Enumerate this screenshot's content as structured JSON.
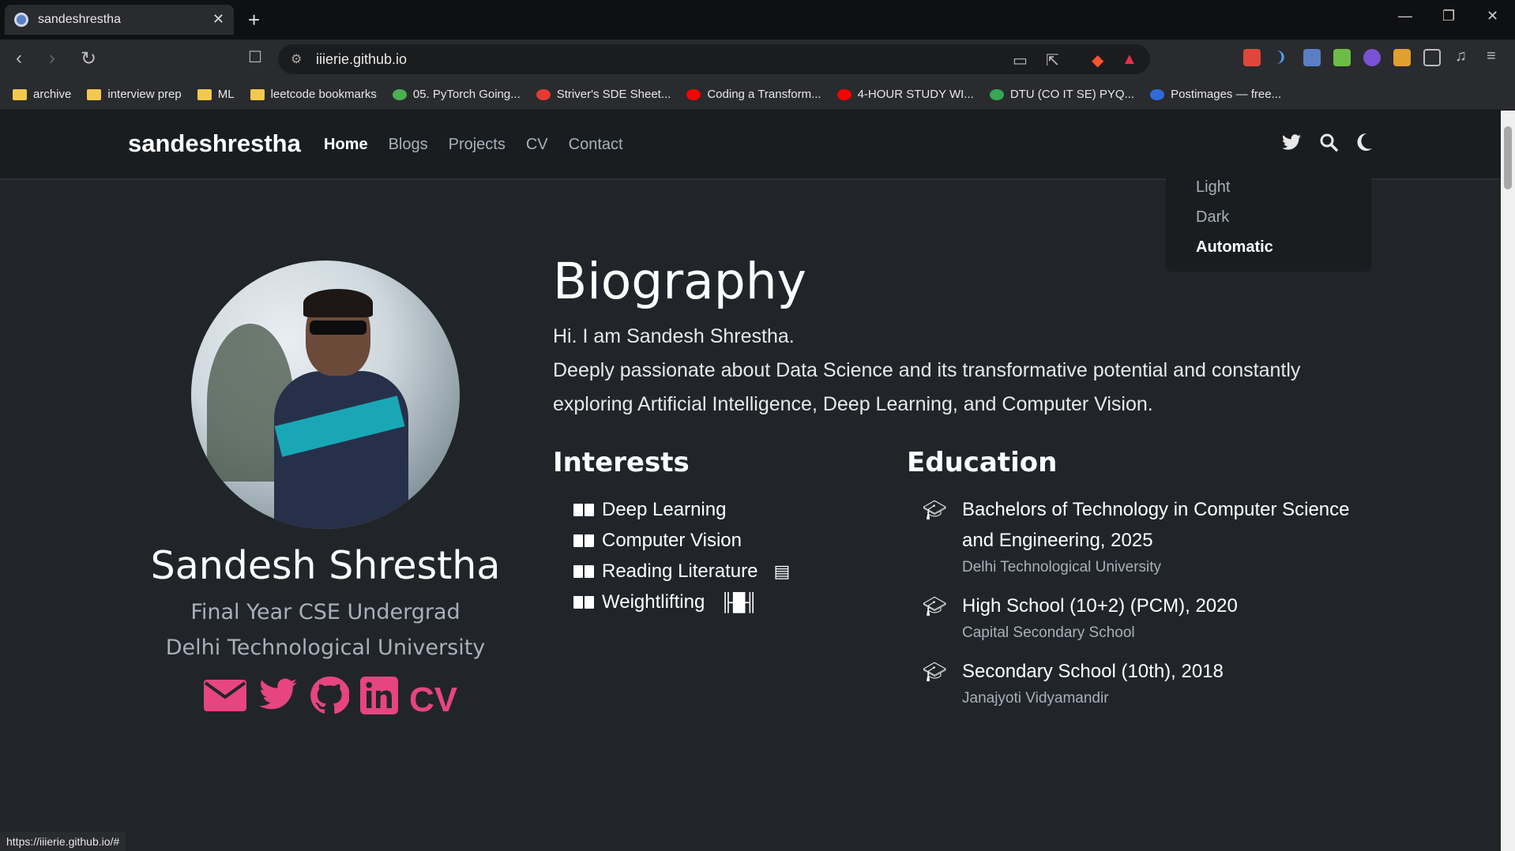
{
  "browser": {
    "tab_title": "sandeshrestha",
    "url": "iiierie.github.io",
    "status_url": "https://iiierie.github.io/#",
    "bookmarks": [
      {
        "label": "archive",
        "icon": "folder-icon"
      },
      {
        "label": "interview prep",
        "icon": "folder-icon"
      },
      {
        "label": "ML",
        "icon": "folder-icon"
      },
      {
        "label": "leetcode bookmarks",
        "icon": "folder-icon"
      },
      {
        "label": "05. PyTorch Going...",
        "icon": "pytorch-icon"
      },
      {
        "label": "Striver's SDE Sheet...",
        "icon": "tuf-icon"
      },
      {
        "label": "Coding a Transform...",
        "icon": "youtube-icon"
      },
      {
        "label": "4-HOUR STUDY WI...",
        "icon": "youtube-icon"
      },
      {
        "label": "DTU (CO IT SE) PYQ...",
        "icon": "drive-icon"
      },
      {
        "label": "Postimages — free...",
        "icon": "postimages-icon"
      }
    ]
  },
  "site": {
    "brand": "sandeshrestha",
    "nav": [
      "Home",
      "Blogs",
      "Projects",
      "CV",
      "Contact"
    ],
    "theme_menu": {
      "options": [
        "Light",
        "Dark",
        "Automatic"
      ],
      "selected": "Automatic"
    }
  },
  "profile": {
    "name": "Sandesh Shrestha",
    "role": "Final Year CSE Undergrad",
    "university": "Delhi Technological University",
    "cv_label": "CV"
  },
  "bio": {
    "title": "Biography",
    "greeting": "Hi. I am Sandesh Shrestha.",
    "description": "Deeply passionate about Data Science and its transformative potential and constantly exploring Artificial Intelligence, Deep Learning, and Computer Vision."
  },
  "interests": {
    "title": "Interests",
    "items": [
      "Deep Learning",
      "Computer Vision",
      "Reading Literature",
      "Weightlifting"
    ]
  },
  "education": {
    "title": "Education",
    "items": [
      {
        "degree": "Bachelors of Technology in Computer Science and Engineering, 2025",
        "institution": "Delhi Technological University"
      },
      {
        "degree": "High School (10+2) (PCM), 2020",
        "institution": "Capital Secondary School"
      },
      {
        "degree": "Secondary School (10th), 2018",
        "institution": "Janajyoti Vidyamandir"
      }
    ]
  },
  "colors": {
    "accent": "#e6457f",
    "background": "#212529",
    "navbar": "#1a1d20"
  }
}
